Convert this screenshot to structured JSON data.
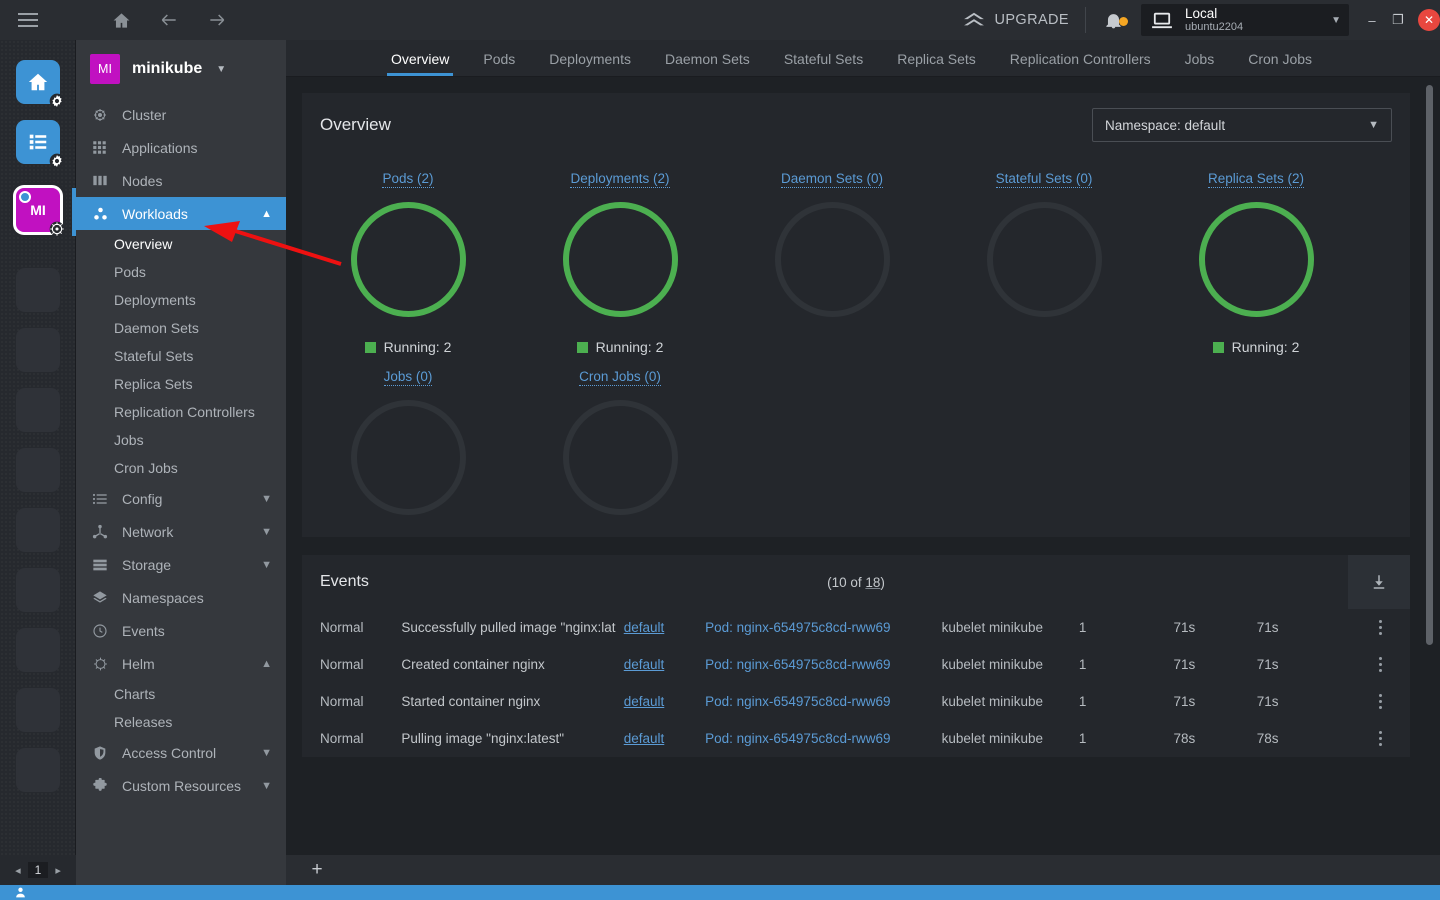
{
  "window": {
    "upgrade_label": "UPGRADE",
    "host_name": "Local",
    "host_sub": "ubuntu2204",
    "minimize": "–",
    "maximize": "❐",
    "close": "✕"
  },
  "dock": {
    "active_tile_label": "MI"
  },
  "sidebar": {
    "context_initials": "MI",
    "context_name": "minikube",
    "items": [
      {
        "label": "Cluster",
        "icon": "helm-wheel-icon",
        "type": "item"
      },
      {
        "label": "Applications",
        "icon": "grid-icon",
        "type": "item"
      },
      {
        "label": "Nodes",
        "icon": "server-icon",
        "type": "item"
      },
      {
        "label": "Workloads",
        "icon": "workloads-icon",
        "type": "group",
        "active": true,
        "expanded": true
      },
      {
        "label": "Overview",
        "type": "sub",
        "current": true
      },
      {
        "label": "Pods",
        "type": "sub"
      },
      {
        "label": "Deployments",
        "type": "sub"
      },
      {
        "label": "Daemon Sets",
        "type": "sub"
      },
      {
        "label": "Stateful Sets",
        "type": "sub"
      },
      {
        "label": "Replica Sets",
        "type": "sub"
      },
      {
        "label": "Replication Controllers",
        "type": "sub"
      },
      {
        "label": "Jobs",
        "type": "sub"
      },
      {
        "label": "Cron Jobs",
        "type": "sub"
      },
      {
        "label": "Config",
        "icon": "list-icon",
        "type": "group",
        "expanded": false
      },
      {
        "label": "Network",
        "icon": "network-icon",
        "type": "group",
        "expanded": false
      },
      {
        "label": "Storage",
        "icon": "storage-icon",
        "type": "group",
        "expanded": false
      },
      {
        "label": "Namespaces",
        "icon": "layers-icon",
        "type": "item"
      },
      {
        "label": "Events",
        "icon": "clock-icon",
        "type": "item"
      },
      {
        "label": "Helm",
        "icon": "helm-icon",
        "type": "group",
        "expanded": true
      },
      {
        "label": "Charts",
        "type": "sub"
      },
      {
        "label": "Releases",
        "type": "sub"
      },
      {
        "label": "Access Control",
        "icon": "shield-icon",
        "type": "group",
        "expanded": false
      },
      {
        "label": "Custom Resources",
        "icon": "puzzle-icon",
        "type": "group",
        "expanded": false
      }
    ]
  },
  "tabs": [
    {
      "label": "Overview",
      "active": true
    },
    {
      "label": "Pods",
      "active": false
    },
    {
      "label": "Deployments",
      "active": false
    },
    {
      "label": "Daemon Sets",
      "active": false
    },
    {
      "label": "Stateful Sets",
      "active": false
    },
    {
      "label": "Replica Sets",
      "active": false
    },
    {
      "label": "Replication Controllers",
      "active": false
    },
    {
      "label": "Jobs",
      "active": false
    },
    {
      "label": "Cron Jobs",
      "active": false
    }
  ],
  "overview": {
    "title": "Overview",
    "namespace_label": "Namespace: default"
  },
  "chart_data": {
    "type": "pie",
    "title": "Workloads Overview",
    "legend_position": "bottom",
    "cards": [
      {
        "title": "Pods (2)",
        "name": "Pods",
        "count": 2,
        "running": 2,
        "legend": "Running: 2",
        "color": "#4caf50"
      },
      {
        "title": "Deployments (2)",
        "name": "Deployments",
        "count": 2,
        "running": 2,
        "legend": "Running: 2",
        "color": "#4caf50"
      },
      {
        "title": "Daemon Sets (0)",
        "name": "Daemon Sets",
        "count": 0,
        "running": 0,
        "legend": "",
        "color": "#2f3338"
      },
      {
        "title": "Stateful Sets (0)",
        "name": "Stateful Sets",
        "count": 0,
        "running": 0,
        "legend": "",
        "color": "#2f3338"
      },
      {
        "title": "Replica Sets (2)",
        "name": "Replica Sets",
        "count": 2,
        "running": 2,
        "legend": "Running: 2",
        "color": "#4caf50"
      },
      {
        "title": "Jobs (0)",
        "name": "Jobs",
        "count": 0,
        "running": 0,
        "legend": "",
        "color": "#2f3338"
      },
      {
        "title": "Cron Jobs (0)",
        "name": "Cron Jobs",
        "count": 0,
        "running": 0,
        "legend": "",
        "color": "#2f3338"
      }
    ]
  },
  "events": {
    "title": "Events",
    "count_prefix": "(10 of ",
    "count_total": "18",
    "count_suffix": ")",
    "rows": [
      {
        "type": "Normal",
        "message": "Successfully pulled image \"nginx:lat",
        "namespace": "default",
        "object": "Pod: nginx-654975c8cd-rww69",
        "source": "kubelet minikube",
        "count": "1",
        "first_seen": "71s",
        "last_seen": "71s"
      },
      {
        "type": "Normal",
        "message": "Created container nginx",
        "namespace": "default",
        "object": "Pod: nginx-654975c8cd-rww69",
        "source": "kubelet minikube",
        "count": "1",
        "first_seen": "71s",
        "last_seen": "71s"
      },
      {
        "type": "Normal",
        "message": "Started container nginx",
        "namespace": "default",
        "object": "Pod: nginx-654975c8cd-rww69",
        "source": "kubelet minikube",
        "count": "1",
        "first_seen": "71s",
        "last_seen": "71s"
      },
      {
        "type": "Normal",
        "message": "Pulling image \"nginx:latest\"",
        "namespace": "default",
        "object": "Pod: nginx-654975c8cd-rww69",
        "source": "kubelet minikube",
        "count": "1",
        "first_seen": "78s",
        "last_seen": "78s"
      }
    ]
  },
  "bottom": {
    "page_number": "1",
    "prev": "◂",
    "next": "▸",
    "add_tab": "+"
  }
}
